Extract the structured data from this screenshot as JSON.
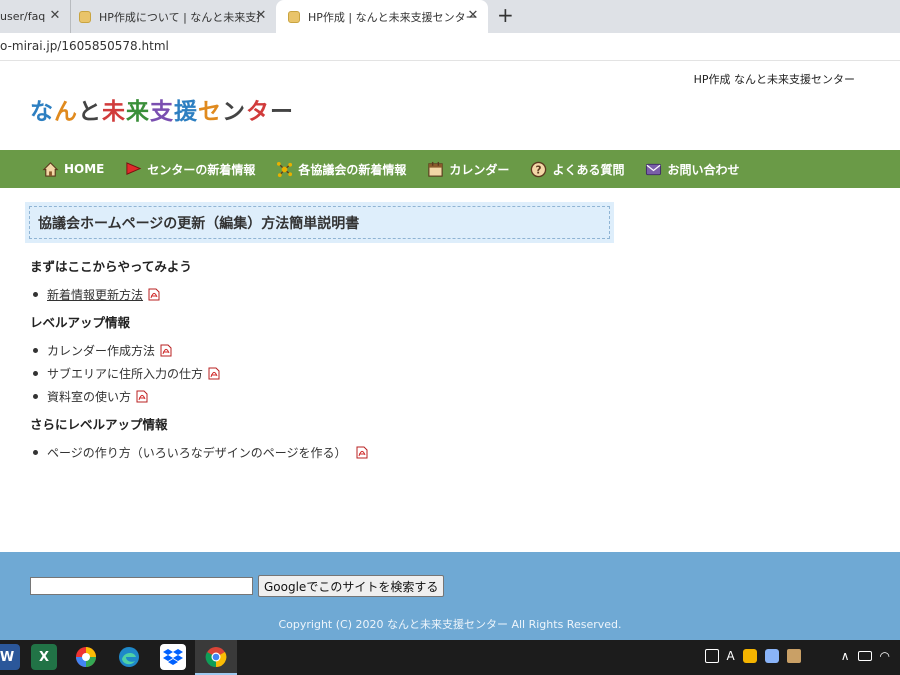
{
  "browser": {
    "tabs": [
      {
        "label": "user/faq",
        "active": false
      },
      {
        "label": "HP作成について | なんと未来支援セ",
        "active": false
      },
      {
        "label": "HP作成 | なんと未来支援センター",
        "active": true
      }
    ],
    "new_tab_label": "+",
    "url": "o-mirai.jp/1605850578.html"
  },
  "header": {
    "site_tagline": "HP作成 なんと未来支援センター",
    "logo_chars": [
      "な",
      "ん",
      "と",
      "未",
      "来",
      "支",
      "援",
      "セ",
      "ン",
      "タ",
      "ー"
    ],
    "logo_colors": [
      "#2d7fc1",
      "#e08a1e",
      "#444444",
      "#d13b3b",
      "#3a8f3a",
      "#7a4fb0",
      "#2d7fc1",
      "#e08a1e",
      "#444444",
      "#d13b3b",
      "#444444"
    ]
  },
  "nav": {
    "items": [
      {
        "label": "HOME",
        "icon": "home-icon"
      },
      {
        "label": "センターの新着情報",
        "icon": "flag-icon"
      },
      {
        "label": "各協議会の新着情報",
        "icon": "network-icon"
      },
      {
        "label": "カレンダー",
        "icon": "calendar-icon"
      },
      {
        "label": "よくある質問",
        "icon": "question-icon"
      },
      {
        "label": "お問い合わせ",
        "icon": "mail-icon"
      }
    ],
    "background": "#6a9a47"
  },
  "main": {
    "title": "協議会ホームページの更新（編集）方法簡単説明書",
    "sections": [
      {
        "heading": "まずはここからやってみよう",
        "items": [
          {
            "label": "新着情報更新方法",
            "underlined": true
          }
        ]
      },
      {
        "heading": "レベルアップ情報",
        "items": [
          {
            "label": "カレンダー作成方法",
            "underlined": false
          },
          {
            "label": "サブエリアに住所入力の仕方",
            "underlined": false
          },
          {
            "label": "資料室の使い方",
            "underlined": false
          }
        ]
      },
      {
        "heading": "さらにレベルアップ情報",
        "items": [
          {
            "label": "ページの作り方（いろいろなデザインのページを作る）",
            "underlined": false
          }
        ]
      }
    ]
  },
  "footer": {
    "search_value": "",
    "search_button": "Googleでこのサイトを検索する",
    "copyright": "Copyright (C) 2020 なんと未来支援センター All Rights Reserved."
  },
  "taskbar": {
    "apps": [
      "word-icon",
      "excel-icon",
      "photos-icon",
      "edge-icon",
      "dropbox-icon",
      "chrome-icon"
    ],
    "tray_ime": "A"
  }
}
